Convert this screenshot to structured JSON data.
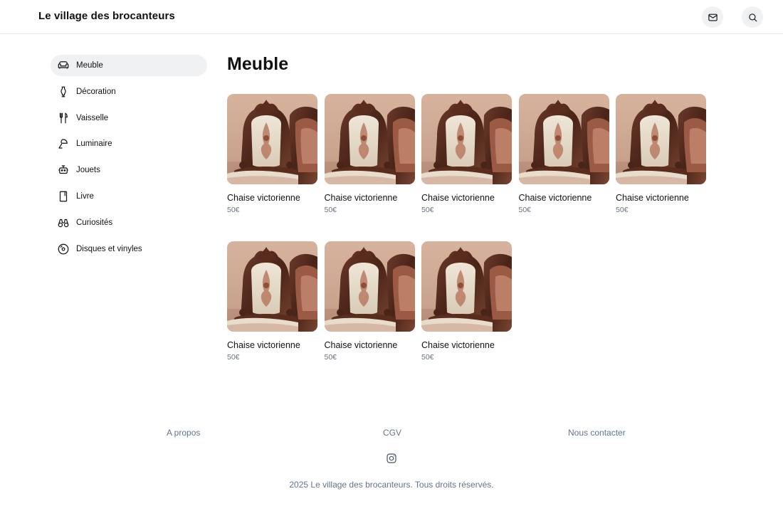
{
  "header": {
    "brand": "Le village des brocanteurs",
    "icons": {
      "mail": "mail-icon",
      "search": "search-icon"
    }
  },
  "sidebar": {
    "items": [
      {
        "label": "Meuble",
        "icon": "sofa-icon",
        "active": true
      },
      {
        "label": "Décoration",
        "icon": "vase-icon",
        "active": false
      },
      {
        "label": "Vaisselle",
        "icon": "utensils-icon",
        "active": false
      },
      {
        "label": "Luminaire",
        "icon": "lamp-icon",
        "active": false
      },
      {
        "label": "Jouets",
        "icon": "toy-icon",
        "active": false
      },
      {
        "label": "Livre",
        "icon": "book-icon",
        "active": false
      },
      {
        "label": "Curiosités",
        "icon": "binoculars-icon",
        "active": false
      },
      {
        "label": "Disques et vinyles",
        "icon": "disc-icon",
        "active": false
      }
    ]
  },
  "main": {
    "title": "Meuble",
    "products": [
      {
        "name": "Chaise victorienne",
        "price": "50€"
      },
      {
        "name": "Chaise victorienne",
        "price": "50€"
      },
      {
        "name": "Chaise victorienne",
        "price": "50€"
      },
      {
        "name": "Chaise victorienne",
        "price": "50€"
      },
      {
        "name": "Chaise victorienne",
        "price": "50€"
      },
      {
        "name": "Chaise victorienne",
        "price": "50€"
      },
      {
        "name": "Chaise victorienne",
        "price": "50€"
      },
      {
        "name": "Chaise victorienne",
        "price": "50€"
      }
    ]
  },
  "footer": {
    "links": {
      "about": "A propos",
      "terms": "CGV",
      "contact": "Nous contacter"
    },
    "social_icon": "instagram-icon",
    "copyright": "2025 Le village des brocanteurs. Tous droits réservés."
  },
  "colors": {
    "active_bg": "#f0f1f3",
    "muted_text": "#64748b",
    "border": "#e5e7eb"
  }
}
